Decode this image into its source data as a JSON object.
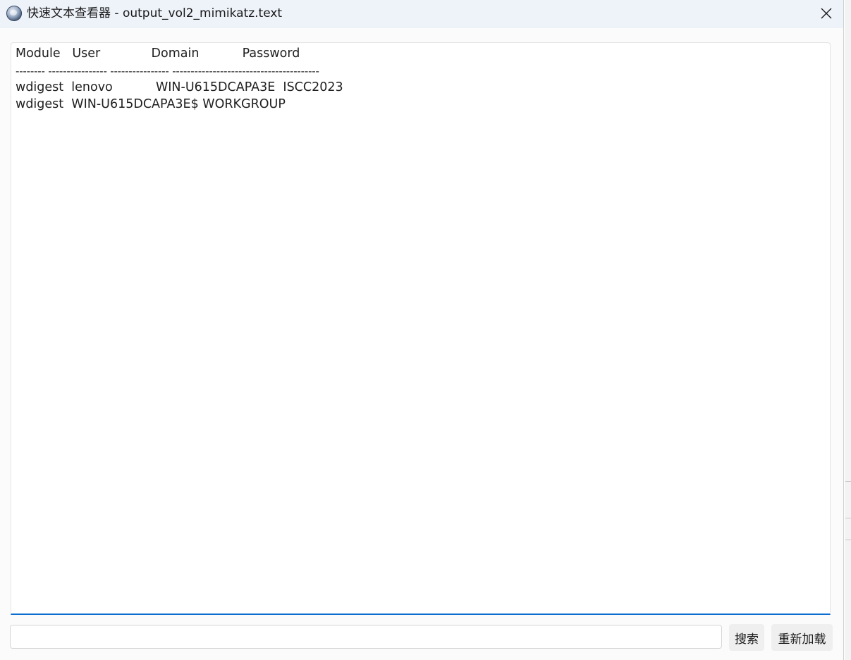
{
  "window": {
    "title": "快速文本查看器 - output_vol2_mimikatz.text",
    "app_icon": "globe-app-icon",
    "close_icon": "close-icon"
  },
  "content": {
    "header_line": "Module   User             Domain           Password",
    "separator_line": "-------- ---------------- ---------------- ----------------------------------------",
    "rows": [
      "wdigest  lenovo           WIN-U615DCAPA3E  ISCC2023",
      "wdigest  WIN-U615DCAPA3E$ WORKGROUP"
    ]
  },
  "search": {
    "value": "",
    "placeholder": ""
  },
  "buttons": {
    "search_label": "搜索",
    "reload_label": "重新加载"
  },
  "colors": {
    "accent": "#0a6ed1",
    "titlebar_bg": "#eef3fa"
  }
}
